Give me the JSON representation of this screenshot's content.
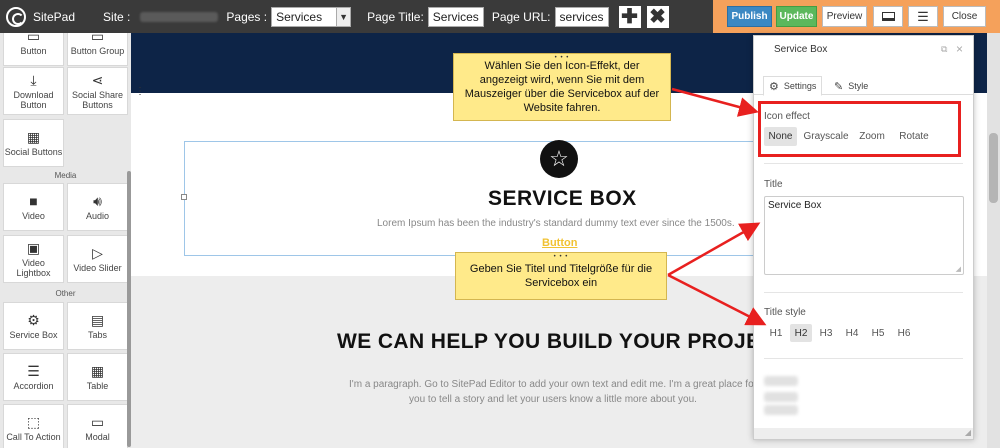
{
  "topbar": {
    "app_name": "SitePad",
    "site_label": "Site :",
    "pages_label": "Pages :",
    "pages_selected": "Services",
    "page_title_label": "Page Title:",
    "page_title_value": "Services",
    "page_url_label": "Page URL:",
    "page_url_value": "services",
    "buttons": {
      "publish": "Publish",
      "update": "Update",
      "preview": "Preview",
      "close": "Close"
    },
    "colors": {
      "topbar": "#3a3a3a",
      "action_zone": "#f5a15b",
      "publish": "#3b88c3",
      "update": "#5cb85c"
    }
  },
  "sidebar": {
    "widgets": [
      {
        "label": "Button",
        "icon": "button-icon"
      },
      {
        "label": "Button Group",
        "icon": "button-group-icon"
      },
      {
        "label": "Download Button",
        "icon": "download-icon"
      },
      {
        "label": "Social Share Buttons",
        "icon": "share-icon"
      },
      {
        "label": "Social Buttons",
        "icon": "social-icon"
      },
      {
        "label": "Video",
        "icon": "video-icon"
      },
      {
        "label": "Audio",
        "icon": "audio-icon"
      },
      {
        "label": "Video Lightbox",
        "icon": "film-icon"
      },
      {
        "label": "Video Slider",
        "icon": "play-icon"
      },
      {
        "label": "Service Box",
        "icon": "gear-icon"
      },
      {
        "label": "Tabs",
        "icon": "tabs-icon"
      },
      {
        "label": "Accordion",
        "icon": "accordion-icon"
      },
      {
        "label": "Table",
        "icon": "table-icon"
      },
      {
        "label": "Call To Action",
        "icon": "cursor-icon"
      },
      {
        "label": "Modal",
        "icon": "modal-icon"
      }
    ],
    "categories": {
      "media": "Media",
      "other": "Other"
    }
  },
  "canvas": {
    "service_box": {
      "icon": "star-icon",
      "title": "SERVICE BOX",
      "text": "Lorem Ipsum has been the industry's standard dummy text ever since the 1500s.",
      "button_label": "Button"
    },
    "help_heading": "WE CAN HELP YOU BUILD YOUR PROJE",
    "paragraph": "I'm a paragraph. Go to SitePad Editor to add your own text and edit me. I'm a great place for you to tell a story and let your users know a little more about you."
  },
  "panel": {
    "title": "Service Box",
    "tabs": {
      "settings": "Settings",
      "style": "Style"
    },
    "icon_effect_label": "Icon effect",
    "icon_effects": [
      "None",
      "Grayscale",
      "Zoom",
      "Rotate"
    ],
    "icon_effect_selected": "None",
    "title_label": "Title",
    "title_value": "Service Box",
    "title_style_label": "Title style",
    "title_styles": [
      "H1",
      "H2",
      "H3",
      "H4",
      "H5",
      "H6"
    ],
    "title_style_selected": "H2"
  },
  "callouts": {
    "icon_effect": "Wählen Sie den Icon-Effekt, der angezeigt wird, wenn Sie mit dem Mauszeiger über die Servicebox auf der Website fahren.",
    "title": "Geben Sie Titel und Titelgröße für die Servicebox ein",
    "color": "#ffea8a",
    "highlight_color": "#e8201f"
  }
}
